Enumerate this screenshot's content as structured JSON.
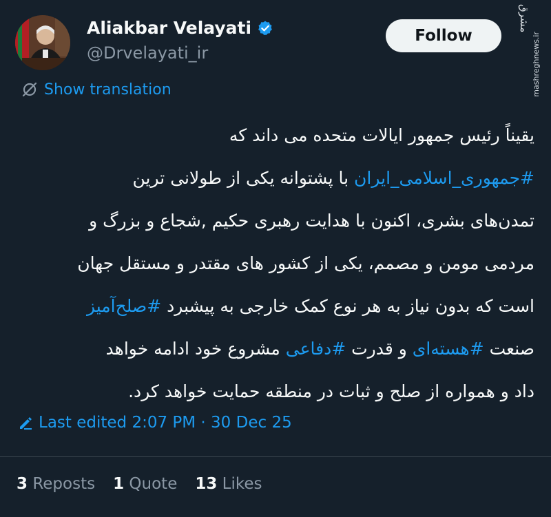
{
  "colors": {
    "background": "#15202b",
    "link": "#1d9bf0",
    "text": "#f7f9f9",
    "muted": "#8b98a5",
    "follow_bg": "#eff3f4"
  },
  "author": {
    "display_name": "Aliakbar Velayati",
    "handle": "@Drvelayati_ir",
    "verified_icon": "verified-badge-icon"
  },
  "header": {
    "follow_label": "Follow"
  },
  "watermark": {
    "logo": "مشرق",
    "site": "mashreghnews.ir"
  },
  "translation": {
    "icon": "translate-icon",
    "label": "Show translation"
  },
  "tweet": {
    "line1": "یقیناً رئیس جمهور ایالات متحده می داند که",
    "line2_hashtag": "#جمهوری_اسلامی_ایران",
    "line2_text": " با پشتوانه یکی از طولانی ترین",
    "line3": "تمدن‌های بشری، اکنون با هدایت رهبری حکیم ,شجاع و بزرگ و",
    "line4": "مردمی مومن و مصمم، یکی از کشور های مقتدر و مستقل جهان",
    "line5_text": "است که بدون نیاز به هر نوع کمک خارجی به پیشبرد ",
    "line5_hashtag": "#صلح‌آمیز",
    "line6_text1": "صنعت ",
    "line6_hashtag1": "#هسته‌ای",
    "line6_text2": " و قدرت ",
    "line6_hashtag2": "#دفاعی",
    "line6_text3": " مشروع خود ادامه خواهد",
    "line7": "داد و همواره از صلح و ثبات در منطقه حمایت خواهد کرد."
  },
  "edited": {
    "icon": "edit-pencil-icon",
    "label": "Last edited 2:07 PM · 30 Dec 25"
  },
  "stats": {
    "reposts_count": "3",
    "reposts_label": "Reposts",
    "quotes_count": "1",
    "quotes_label": "Quote",
    "likes_count": "13",
    "likes_label": "Likes"
  }
}
